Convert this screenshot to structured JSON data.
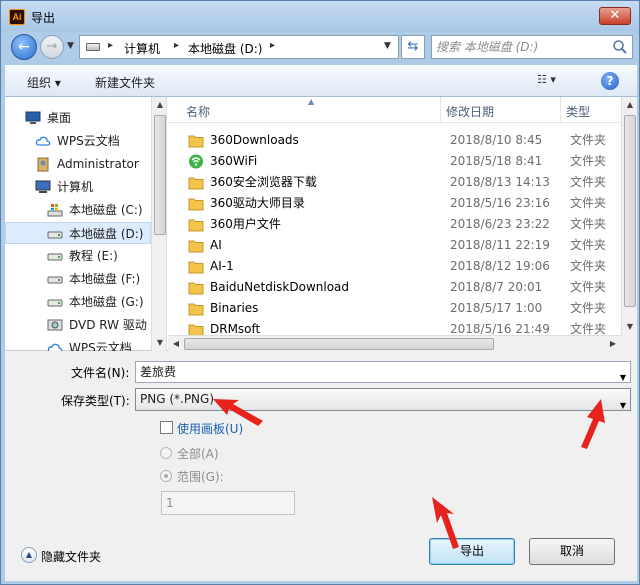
{
  "window": {
    "title": "导出",
    "app_icon": "Ai",
    "close_icon": "close-icon"
  },
  "address": {
    "crumbs": [
      "计算机",
      "本地磁盘 (D:)"
    ],
    "search_placeholder": "搜索 本地磁盘 (D:)"
  },
  "toolbar": {
    "organize": "组织 ▾",
    "new_folder": "新建文件夹",
    "view": "☷ ▾",
    "help": "?"
  },
  "nav": {
    "items": [
      {
        "label": "桌面",
        "icon": "desktop-icon"
      },
      {
        "label": "WPS云文档",
        "icon": "cloud-icon"
      },
      {
        "label": "Administrator",
        "icon": "user-icon"
      },
      {
        "label": "计算机",
        "icon": "computer-icon"
      },
      {
        "label": "本地磁盘 (C:)",
        "icon": "system-drive-icon"
      },
      {
        "label": "本地磁盘 (D:)",
        "icon": "drive-icon",
        "selected": true
      },
      {
        "label": "教程 (E:)",
        "icon": "drive-icon"
      },
      {
        "label": "本地磁盘 (F:)",
        "icon": "drive-icon"
      },
      {
        "label": "本地磁盘 (G:)",
        "icon": "drive-icon"
      },
      {
        "label": "DVD RW 驱动",
        "icon": "dvd-drive-icon"
      },
      {
        "label": "WPS云文档",
        "icon": "cloud-icon"
      }
    ]
  },
  "files": {
    "columns": {
      "name": "名称",
      "date": "修改日期",
      "type": "类型"
    },
    "rows": [
      {
        "name": "360Downloads",
        "date": "2018/8/10 8:45",
        "type": "文件夹",
        "icon": "folder-icon"
      },
      {
        "name": "360WiFi",
        "date": "2018/5/18 8:41",
        "type": "文件夹",
        "icon": "wifi-folder-icon"
      },
      {
        "name": "360安全浏览器下载",
        "date": "2018/8/13 14:13",
        "type": "文件夹",
        "icon": "folder-icon"
      },
      {
        "name": "360驱动大师目录",
        "date": "2018/5/16 23:16",
        "type": "文件夹",
        "icon": "folder-icon"
      },
      {
        "name": "360用户文件",
        "date": "2018/6/23 23:22",
        "type": "文件夹",
        "icon": "folder-icon"
      },
      {
        "name": "AI",
        "date": "2018/8/11 22:19",
        "type": "文件夹",
        "icon": "folder-icon"
      },
      {
        "name": "AI-1",
        "date": "2018/8/12 19:06",
        "type": "文件夹",
        "icon": "folder-icon"
      },
      {
        "name": "BaiduNetdiskDownload",
        "date": "2018/8/7 20:01",
        "type": "文件夹",
        "icon": "folder-icon"
      },
      {
        "name": "Binaries",
        "date": "2018/5/17 1:00",
        "type": "文件夹",
        "icon": "folder-icon"
      },
      {
        "name": "DRMsoft",
        "date": "2018/5/16 21:49",
        "type": "文件夹",
        "icon": "folder-icon"
      }
    ]
  },
  "form": {
    "filename_label": "文件名(N):",
    "filename_value": "差旅费",
    "filetype_label": "保存类型(T):",
    "filetype_value": "PNG (*.PNG)",
    "use_artboard_label": "使用画板(U)",
    "all_label": "全部(A)",
    "range_label": "范围(G):",
    "range_value": "1"
  },
  "footer": {
    "hide_folders": "隐藏文件夹",
    "export_button": "导出",
    "cancel_button": "取消"
  },
  "colors": {
    "annotation_red": "#e8231e",
    "titlebar": "#b8d2ee",
    "selected": "#dcecfc"
  }
}
